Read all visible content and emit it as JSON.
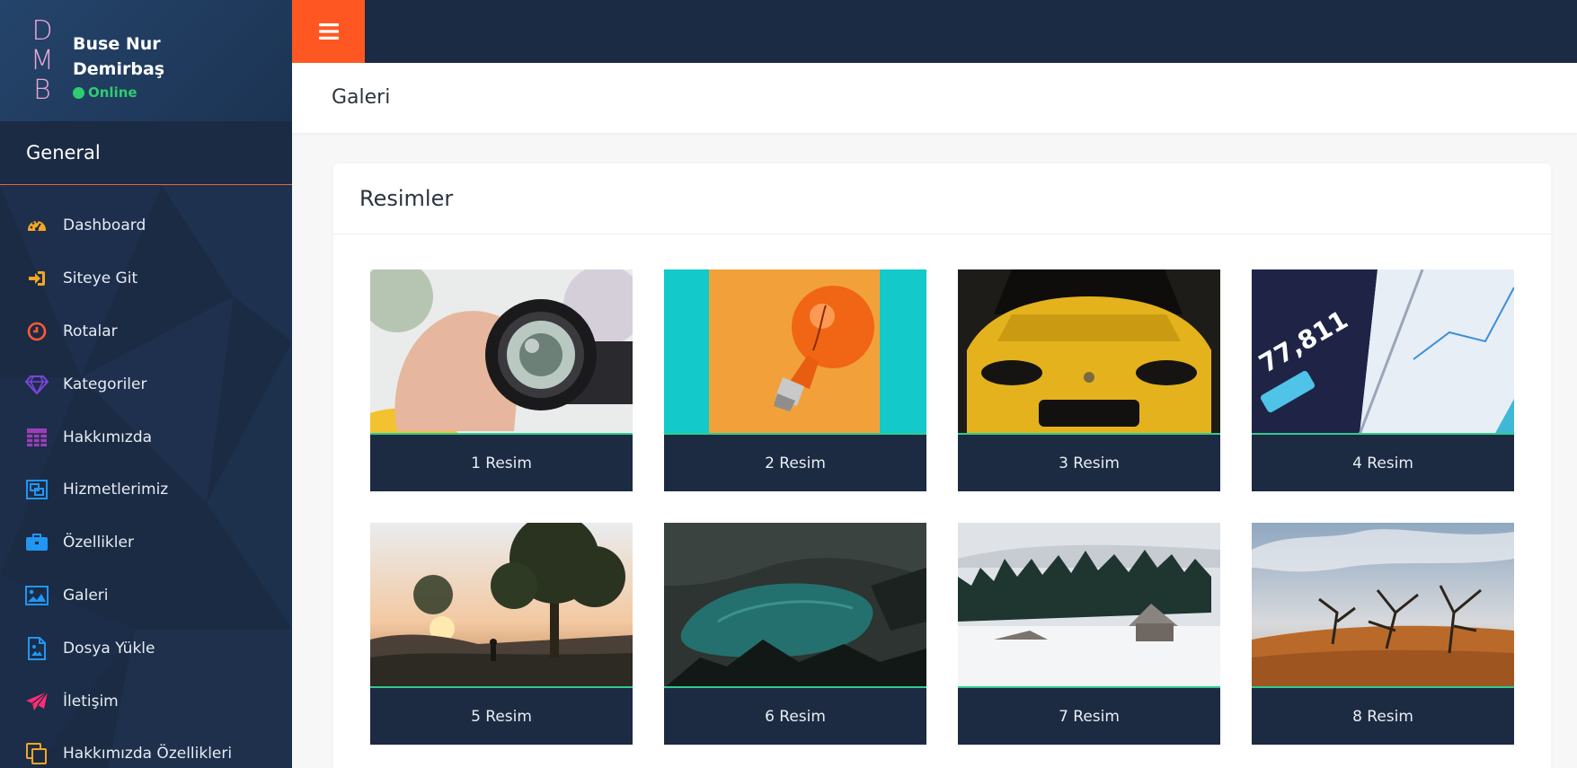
{
  "profile": {
    "logo_letters": [
      "D",
      "M",
      "B"
    ],
    "name": "Buse Nur Demirbaş",
    "status": "Online"
  },
  "sidebar": {
    "section_title": "General",
    "items": [
      {
        "label": "Dashboard",
        "icon": "dashboard-icon",
        "color": "#f5a623"
      },
      {
        "label": "Siteye Git",
        "icon": "sign-in-icon",
        "color": "#f5a623"
      },
      {
        "label": "Rotalar",
        "icon": "clock-icon",
        "color": "#ff5a36"
      },
      {
        "label": "Kategoriler",
        "icon": "diamond-icon",
        "color": "#7b45d9"
      },
      {
        "label": "Hakkımızda",
        "icon": "table-icon",
        "color": "#9b3fb8"
      },
      {
        "label": "Hizmetlerimiz",
        "icon": "object-group-icon",
        "color": "#2196f3"
      },
      {
        "label": "Özellikler",
        "icon": "briefcase-icon",
        "color": "#2196f3"
      },
      {
        "label": "Galeri",
        "icon": "image-icon",
        "color": "#2196f3"
      },
      {
        "label": "Dosya Yükle",
        "icon": "file-image-icon",
        "color": "#2196f3"
      },
      {
        "label": "İletişim",
        "icon": "paper-plane-icon",
        "color": "#ff2d73"
      },
      {
        "label": "Hakkımızda Özellikleri",
        "icon": "copy-icon",
        "color": "#f5a623"
      }
    ]
  },
  "topbar": {
    "menu_icon": "hamburger-icon",
    "accent": "#fe5722"
  },
  "page": {
    "title": "Galeri"
  },
  "card": {
    "title": "Resimler"
  },
  "gallery": {
    "items": [
      {
        "caption": "1 Resim",
        "image": "camera-lens-photo"
      },
      {
        "caption": "2 Resim",
        "image": "light-bulb-photo"
      },
      {
        "caption": "3 Resim",
        "image": "yellow-car-photo"
      },
      {
        "caption": "4 Resim",
        "image": "analytics-tablet-photo"
      },
      {
        "caption": "5 Resim",
        "image": "sunset-tree-photo"
      },
      {
        "caption": "6 Resim",
        "image": "mountain-lake-photo"
      },
      {
        "caption": "7 Resim",
        "image": "snowy-cabin-photo"
      },
      {
        "caption": "8 Resim",
        "image": "savanna-trees-photo"
      }
    ]
  }
}
